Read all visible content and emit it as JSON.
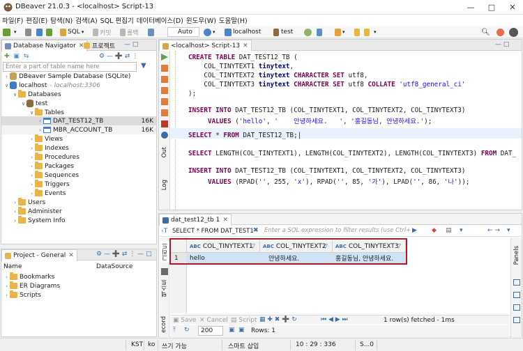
{
  "window": {
    "title": "DBeaver 21.0.3 - <localhost> Script-13",
    "controls": [
      "minimize-icon",
      "maximize-icon",
      "close-icon"
    ]
  },
  "menu": [
    "파일(F)",
    "편집(E)",
    "탐색(N)",
    "검색(A)",
    "SQL 편집기",
    "데이터베이스(D)",
    "윈도우(W)",
    "도움말(H)"
  ],
  "toolbar": {
    "sql_label": "SQL",
    "commit_label": "커밋",
    "rollback_label": "롤백",
    "tx_mode": "Auto",
    "connection": "localhost",
    "schema": "test"
  },
  "navigator": {
    "tab_label": "Database Navigator",
    "tab2_label": "프로젝트",
    "filter_placeholder": "Enter a part of table name here",
    "tree": {
      "sample_db": "DBeaver Sample Database (SQLite)",
      "localhost": "localhost",
      "localhost_host": "- localhost:3306",
      "databases": "Databases",
      "test": "test",
      "tables": "Tables",
      "table1": "DAT_TEST12_TB",
      "table1_size": "16K",
      "table2": "MBR_ACCOUNT_TB",
      "table2_size": "16K",
      "views": "Views",
      "indexes": "Indexes",
      "procedures": "Procedures",
      "packages": "Packages",
      "sequences": "Sequences",
      "triggers": "Triggers",
      "events": "Events",
      "users": "Users",
      "administer": "Administer",
      "sysinfo": "System Info"
    }
  },
  "project": {
    "tab_label": "Project - General",
    "col_name": "Name",
    "col_ds": "DataSource",
    "items": [
      "Bookmarks",
      "ER Diagrams",
      "Scripts"
    ]
  },
  "editor": {
    "tab_label": "<localhost> Script-13",
    "side_labels": [
      "Out",
      "Log"
    ]
  },
  "results": {
    "tab_label": "dat_test12_tb 1",
    "filter_sql": "SELECT * FROM DAT_TEST1",
    "filter_placeholder": "Enter a SQL expression to filter results (use Ctrl+S",
    "columns": [
      "COL_TINYTEXT1",
      "COL_TINYTEXT2",
      "COL_TINYTEXT3"
    ],
    "rows": [
      {
        "num": "1",
        "cells": [
          "hello",
          "안녕하세요.",
          "홍길동님, 안녕하세요."
        ]
      }
    ],
    "side_tabs": [
      "그리드",
      "텍스트",
      "ecord"
    ],
    "panels_label": "Panels",
    "bottom": {
      "save": "Save",
      "cancel": "Cancel",
      "script": "Script",
      "fetched": "1 row(s) fetched - 1ms",
      "fetch_size": "200",
      "rows_label": "Rows: 1"
    }
  },
  "status": {
    "tz": "KST",
    "locale": "ko",
    "mode": "쓰기 가능",
    "insert": "스마트 삽입",
    "pos": "10 : 29 : 336",
    "sel": "S...0"
  },
  "colors": {
    "keyword": "#7f0055",
    "string": "#2a00ff",
    "selection": "#cfe3f5",
    "highlight_box": "#b0182a",
    "accent": "#3c6ca8"
  }
}
